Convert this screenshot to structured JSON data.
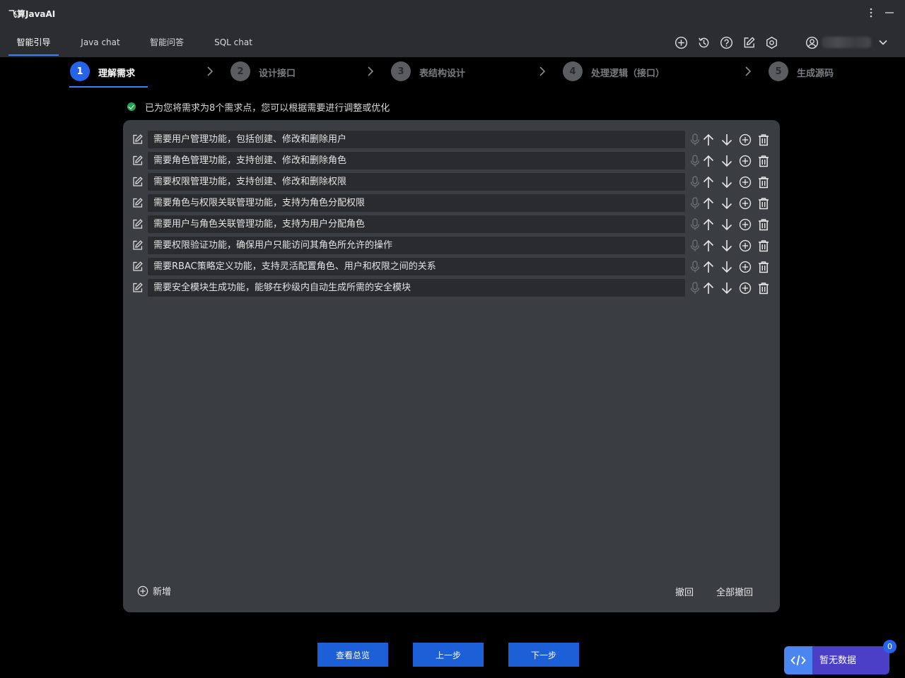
{
  "app": {
    "title": "飞算JavaAI"
  },
  "tabs": [
    {
      "label": "智能引导",
      "active": true
    },
    {
      "label": "Java chat",
      "active": false
    },
    {
      "label": "智能问答",
      "active": false
    },
    {
      "label": "SQL chat",
      "active": false
    }
  ],
  "toolbar_icons": [
    "add-circle-icon",
    "history-icon",
    "help-icon",
    "edit-icon",
    "settings-icon",
    "user-icon",
    "chevron-down-icon"
  ],
  "steps": [
    {
      "number": "1",
      "label": "理解需求",
      "active": true
    },
    {
      "number": "2",
      "label": "设计接口",
      "active": false
    },
    {
      "number": "3",
      "label": "表结构设计",
      "active": false
    },
    {
      "number": "4",
      "label": "处理逻辑（接口）",
      "active": false
    },
    {
      "number": "5",
      "label": "生成源码",
      "active": false
    }
  ],
  "notice": "已为您将需求为8个需求点，您可以根据需要进行调整或优化",
  "requirements": [
    "需要用户管理功能，包括创建、修改和删除用户",
    "需要角色管理功能，支持创建、修改和删除角色",
    "需要权限管理功能，支持创建、修改和删除权限",
    "需要角色与权限关联管理功能，支持为角色分配权限",
    "需要用户与角色关联管理功能，支持为用户分配角色",
    "需要权限验证功能，确保用户只能访问其角色所允许的操作",
    "需要RBAC策略定义功能，支持灵活配置角色、用户和权限之间的关系",
    "需要安全模块生成功能，能够在秒级内自动生成所需的安全模块"
  ],
  "panel_actions": {
    "add": "新增",
    "undo": "撤回",
    "undo_all": "全部撤回"
  },
  "bottom_buttons": {
    "overview": "查看总览",
    "prev": "上一步",
    "next": "下一步"
  },
  "floating": {
    "label": "暂无数据",
    "badge": "0"
  },
  "colors": {
    "accent": "#2563eb",
    "panel": "#3a3d41",
    "success": "#22a150",
    "floating": "#4a3fc6"
  }
}
